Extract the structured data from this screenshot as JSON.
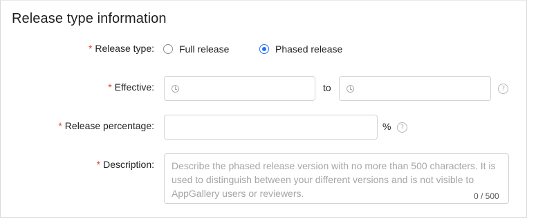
{
  "section": {
    "title": "Release type information"
  },
  "release_type": {
    "required_mark": "*",
    "label": "Release type:",
    "options": [
      {
        "label": "Full release",
        "checked": false
      },
      {
        "label": "Phased release",
        "checked": true
      }
    ]
  },
  "effective": {
    "required_mark": "*",
    "label": "Effective:",
    "start_value": "",
    "range_separator": "to",
    "end_value": "",
    "help_icon": "question-circle-icon",
    "clock_icon": "clock-icon"
  },
  "release_percentage": {
    "required_mark": "*",
    "label": "Release percentage:",
    "value": "",
    "unit": "%",
    "help_icon": "question-circle-icon"
  },
  "description": {
    "required_mark": "*",
    "label": "Description:",
    "value": "",
    "placeholder": "Describe the phased release version with no more than 500 characters. It is used to distinguish between your different versions and is not visible to AppGallery users or reviewers.",
    "counter": "0 / 500"
  },
  "colors": {
    "accent": "#256fff",
    "required": "#e84026"
  }
}
